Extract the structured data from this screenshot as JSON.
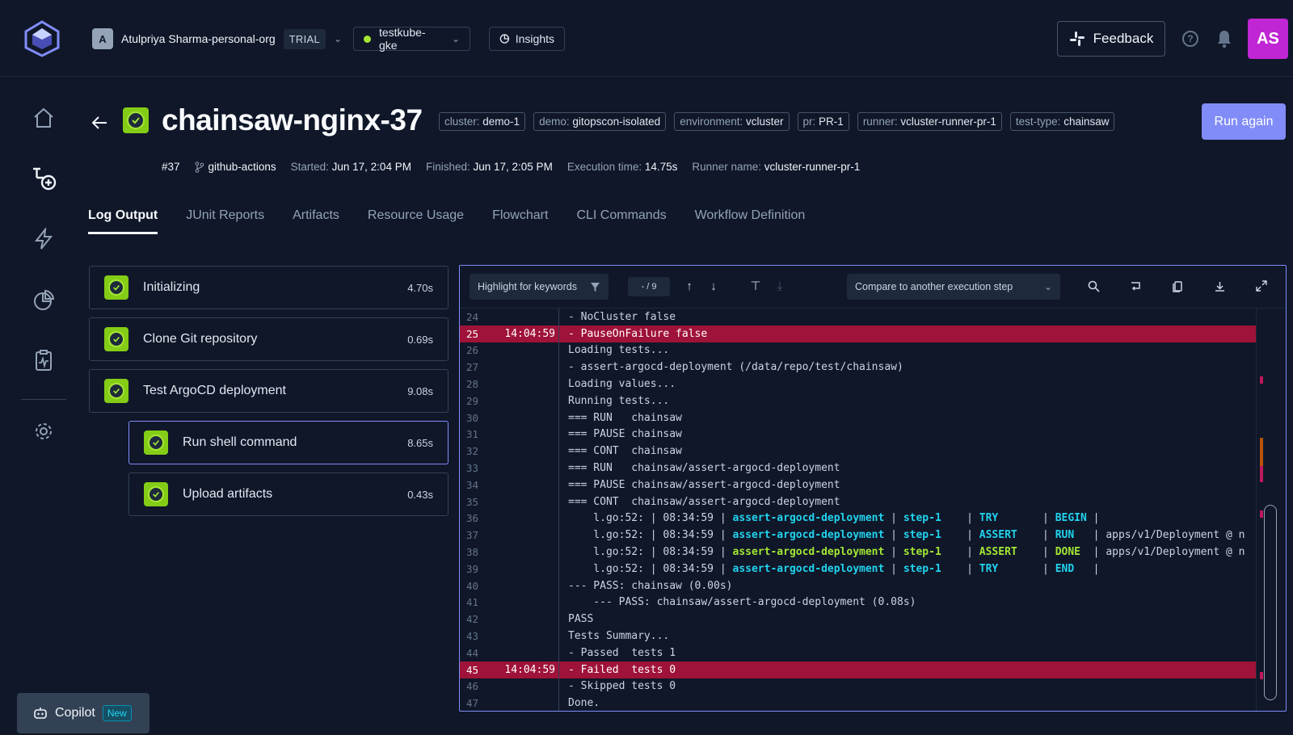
{
  "topbar": {
    "org_initial": "A",
    "org_name": "Atulpriya Sharma-personal-org",
    "trial": "TRIAL",
    "environment": "testkube-gke",
    "insights": "Insights",
    "feedback": "Feedback",
    "user_initials": "AS"
  },
  "header": {
    "title": "chainsaw-nginx-37",
    "run_again": "Run again",
    "labels": [
      {
        "k": "cluster:",
        "v": "demo-1"
      },
      {
        "k": "demo:",
        "v": "gitopscon-isolated"
      },
      {
        "k": "environment:",
        "v": "vcluster"
      },
      {
        "k": "pr:",
        "v": "PR-1"
      },
      {
        "k": "runner:",
        "v": "vcluster-runner-pr-1"
      },
      {
        "k": "test-type:",
        "v": "chainsaw"
      }
    ],
    "meta": {
      "number": "#37",
      "source": "github-actions",
      "started_k": "Started:",
      "started_v": "Jun 17, 2:04 PM",
      "finished_k": "Finished:",
      "finished_v": "Jun 17, 2:05 PM",
      "exec_k": "Execution time:",
      "exec_v": "14.75s",
      "runner_k": "Runner name:",
      "runner_v": "vcluster-runner-pr-1"
    }
  },
  "tabs": [
    "Log Output",
    "JUnit Reports",
    "Artifacts",
    "Resource Usage",
    "Flowchart",
    "CLI Commands",
    "Workflow Definition"
  ],
  "steps": [
    {
      "name": "Initializing",
      "duration": "4.70s"
    },
    {
      "name": "Clone Git repository",
      "duration": "0.69s"
    },
    {
      "name": "Test ArgoCD deployment",
      "duration": "9.08s"
    },
    {
      "name": "Run shell command",
      "duration": "8.65s"
    },
    {
      "name": "Upload artifacts",
      "duration": "0.43s"
    }
  ],
  "log_toolbar": {
    "keywords": "Highlight for keywords",
    "counter": "- / 9",
    "compare": "Compare to another execution step"
  },
  "log_lines": [
    {
      "n": "24",
      "ts": "",
      "t": "- NoCluster false"
    },
    {
      "n": "25",
      "ts": "14:04:59",
      "t": "- PauseOnFailure false",
      "hl": true
    },
    {
      "n": "26",
      "ts": "",
      "t": "Loading tests..."
    },
    {
      "n": "27",
      "ts": "",
      "t": "- assert-argocd-deployment (/data/repo/test/chainsaw)"
    },
    {
      "n": "28",
      "ts": "",
      "t": "Loading values..."
    },
    {
      "n": "29",
      "ts": "",
      "t": "Running tests..."
    },
    {
      "n": "30",
      "ts": "",
      "t": "=== RUN   chainsaw"
    },
    {
      "n": "31",
      "ts": "",
      "t": "=== PAUSE chainsaw"
    },
    {
      "n": "32",
      "ts": "",
      "t": "=== CONT  chainsaw"
    },
    {
      "n": "33",
      "ts": "",
      "t": "=== RUN   chainsaw/assert-argocd-deployment"
    },
    {
      "n": "34",
      "ts": "",
      "t": "=== PAUSE chainsaw/assert-argocd-deployment"
    },
    {
      "n": "35",
      "ts": "",
      "t": "=== CONT  chainsaw/assert-argocd-deployment"
    },
    {
      "n": "36",
      "ts": "",
      "t": "    l.go:52: | 08:34:59 | ",
      "parts": [
        [
          "assert-argocd-deployment",
          "c-cyan"
        ],
        [
          " | ",
          ""
        ],
        [
          "step-1",
          "c-cyan"
        ],
        [
          "    | ",
          ""
        ],
        [
          "TRY",
          "c-cyan"
        ],
        [
          "       | ",
          ""
        ],
        [
          "BEGIN",
          "c-cyan"
        ],
        [
          " |",
          ""
        ]
      ]
    },
    {
      "n": "37",
      "ts": "",
      "t": "    l.go:52: | 08:34:59 | ",
      "parts": [
        [
          "assert-argocd-deployment",
          "c-cyan"
        ],
        [
          " | ",
          ""
        ],
        [
          "step-1",
          "c-cyan"
        ],
        [
          "    | ",
          ""
        ],
        [
          "ASSERT",
          "c-cyan"
        ],
        [
          "    | ",
          ""
        ],
        [
          "RUN",
          "c-cyan"
        ],
        [
          "   | apps/v1/Deployment @ n",
          ""
        ]
      ]
    },
    {
      "n": "38",
      "ts": "",
      "t": "    l.go:52: | 08:34:59 | ",
      "parts": [
        [
          "assert-argocd-deployment",
          "c-green"
        ],
        [
          " | ",
          ""
        ],
        [
          "step-1",
          "c-green"
        ],
        [
          "    | ",
          ""
        ],
        [
          "ASSERT",
          "c-green"
        ],
        [
          "    | ",
          ""
        ],
        [
          "DONE",
          "c-green"
        ],
        [
          "  | apps/v1/Deployment @ n",
          ""
        ]
      ]
    },
    {
      "n": "39",
      "ts": "",
      "t": "    l.go:52: | 08:34:59 | ",
      "parts": [
        [
          "assert-argocd-deployment",
          "c-cyan"
        ],
        [
          " | ",
          ""
        ],
        [
          "step-1",
          "c-cyan"
        ],
        [
          "    | ",
          ""
        ],
        [
          "TRY",
          "c-cyan"
        ],
        [
          "       | ",
          ""
        ],
        [
          "END",
          "c-cyan"
        ],
        [
          "   |",
          ""
        ]
      ]
    },
    {
      "n": "40",
      "ts": "",
      "t": "--- PASS: chainsaw (0.00s)"
    },
    {
      "n": "41",
      "ts": "",
      "t": "    --- PASS: chainsaw/assert-argocd-deployment (0.08s)"
    },
    {
      "n": "42",
      "ts": "",
      "t": "PASS"
    },
    {
      "n": "43",
      "ts": "",
      "t": "Tests Summary..."
    },
    {
      "n": "44",
      "ts": "",
      "t": "- Passed  tests 1"
    },
    {
      "n": "45",
      "ts": "14:04:59",
      "t": "- Failed  tests 0",
      "hl": true
    },
    {
      "n": "46",
      "ts": "",
      "t": "- Skipped tests 0"
    },
    {
      "n": "47",
      "ts": "",
      "t": "Done."
    }
  ],
  "copilot": {
    "label": "Copilot",
    "badge": "New"
  },
  "colors": {
    "accent": "#818cf8",
    "success": "#84cc16",
    "highlight": "#9f1239",
    "avatar": "#c026d3"
  }
}
